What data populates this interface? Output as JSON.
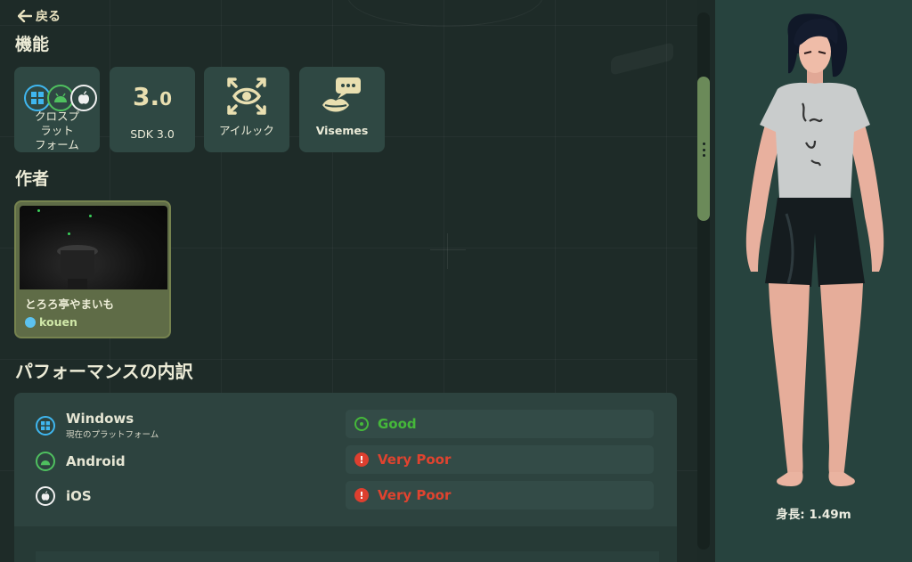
{
  "nav": {
    "back_label": "戻る"
  },
  "features": {
    "title": "機能",
    "tiles": [
      {
        "label": "クロスプ\nラット\nフォーム",
        "icons": [
          "windows-icon",
          "android-icon",
          "apple-icon"
        ]
      },
      {
        "big_major": "3.",
        "big_minor": "0",
        "label": "SDK 3.0"
      },
      {
        "label": "アイルック",
        "icon": "eye-look-icon"
      },
      {
        "label": "Visemes",
        "icon": "viseme-lips-icon"
      }
    ]
  },
  "author": {
    "title": "作者",
    "world_name": "とろろ亭やまいも",
    "username": "kouen",
    "status_color": "#5cc2ef"
  },
  "performance": {
    "title": "パフォーマンスの内訳",
    "rows": [
      {
        "platform": "Windows",
        "sub": "現在のプラットフォーム",
        "rating": "Good",
        "icon": "windows-icon",
        "status": "good"
      },
      {
        "platform": "Android",
        "rating": "Very Poor",
        "icon": "android-icon",
        "status": "poor"
      },
      {
        "platform": "iOS",
        "rating": "Very Poor",
        "icon": "apple-icon",
        "status": "poor"
      }
    ]
  },
  "avatar": {
    "height_label": "身長: 1.49m"
  },
  "colors": {
    "good": "#45b83a",
    "poor": "#e0432f",
    "windows": "#3fb6ef",
    "android": "#4fc05f",
    "scroll_thumb": "#6b8a59"
  }
}
